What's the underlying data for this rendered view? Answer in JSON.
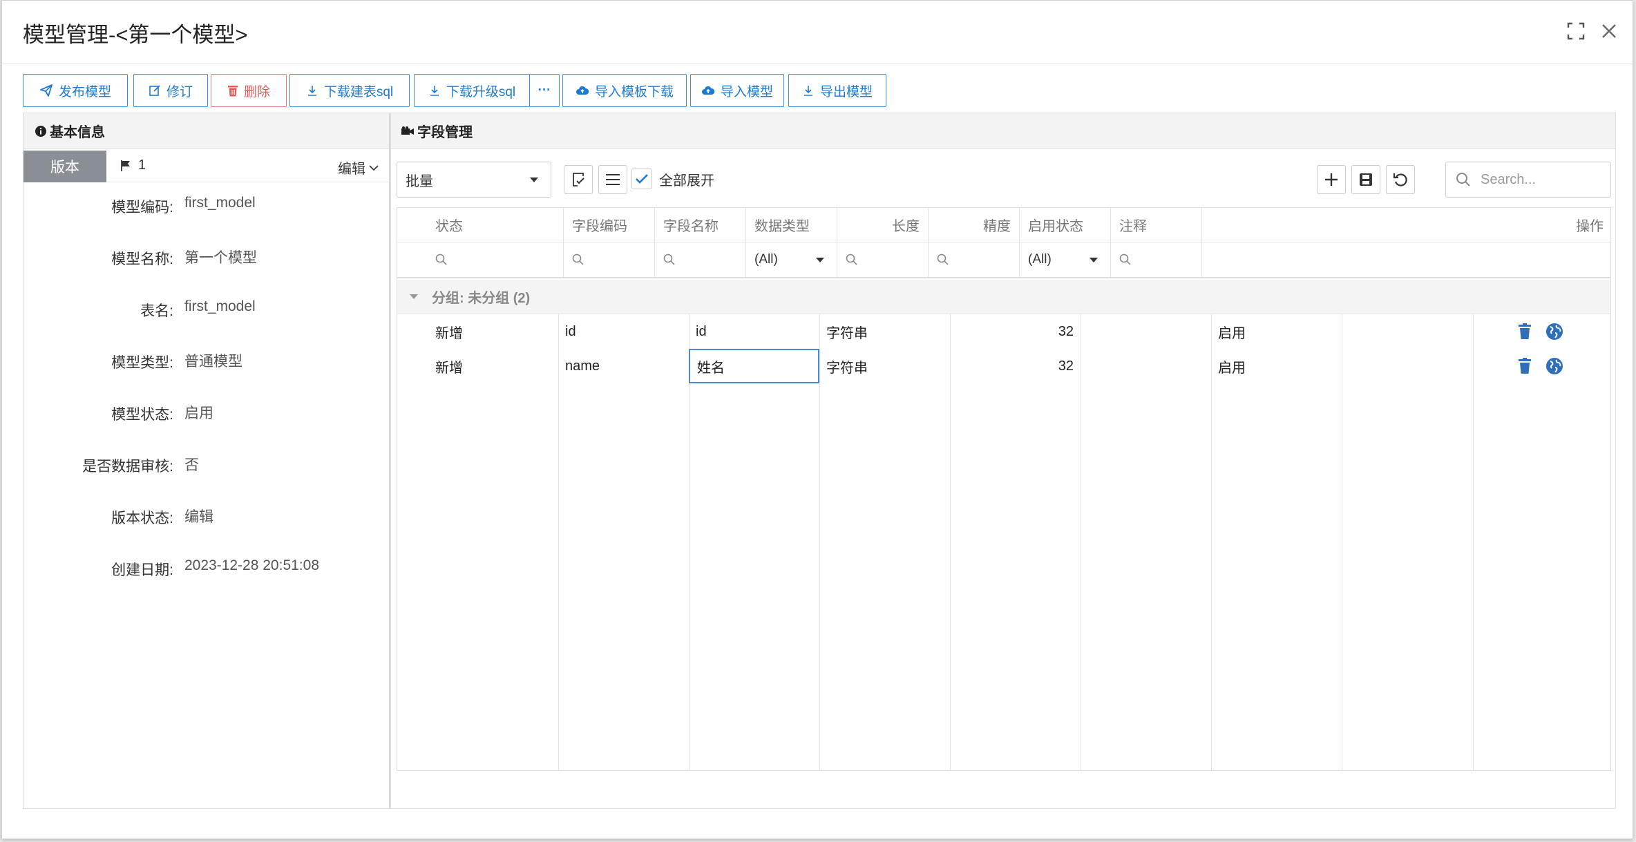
{
  "dialog": {
    "title": "模型管理-<第一个模型>"
  },
  "toolbar": {
    "publish": "发布模型",
    "revise": "修订",
    "delete": "删除",
    "download_create_sql": "下载建表sql",
    "download_upgrade_sql": "下载升级sql",
    "more": "···",
    "import_template_download": "导入模板下载",
    "import_model": "导入模型",
    "export_model": "导出模型"
  },
  "left_panel": {
    "title": "基本信息",
    "version_tab": "版本",
    "version_number": "1",
    "version_status": "编辑",
    "fields": [
      {
        "label": "模型编码:",
        "value": "first_model"
      },
      {
        "label": "模型名称:",
        "value": "第一个模型"
      },
      {
        "label": "表名:",
        "value": "first_model"
      },
      {
        "label": "模型类型:",
        "value": "普通模型"
      },
      {
        "label": "模型状态:",
        "value": "启用"
      },
      {
        "label": "是否数据审核:",
        "value": "否"
      },
      {
        "label": "版本状态:",
        "value": "编辑"
      },
      {
        "label": "创建日期:",
        "value": "2023-12-28 20:51:08"
      }
    ]
  },
  "right_panel": {
    "title": "字段管理",
    "batch_select": "批量",
    "expand_all_label": "全部展开",
    "expand_all_checked": true,
    "search_placeholder": "Search...",
    "columns": [
      "状态",
      "字段编码",
      "字段名称",
      "数据类型",
      "长度",
      "精度",
      "启用状态",
      "注释",
      "操作"
    ],
    "filters": {
      "data_type": "(All)",
      "enable_status": "(All)"
    },
    "group_label": "分组: 未分组 (2)",
    "rows": [
      {
        "status": "新增",
        "code": "id",
        "name": "id",
        "type": "字符串",
        "length": "32",
        "precision": "",
        "enabled": "启用",
        "comment": ""
      },
      {
        "status": "新增",
        "code": "name",
        "name": "姓名",
        "type": "字符串",
        "length": "32",
        "precision": "",
        "enabled": "启用",
        "comment": ""
      }
    ]
  },
  "colors": {
    "accent": "#1e7ad0",
    "danger": "#e05b5b",
    "version_tab_bg": "#8a8e95",
    "action_icon": "#2f6fb8"
  }
}
